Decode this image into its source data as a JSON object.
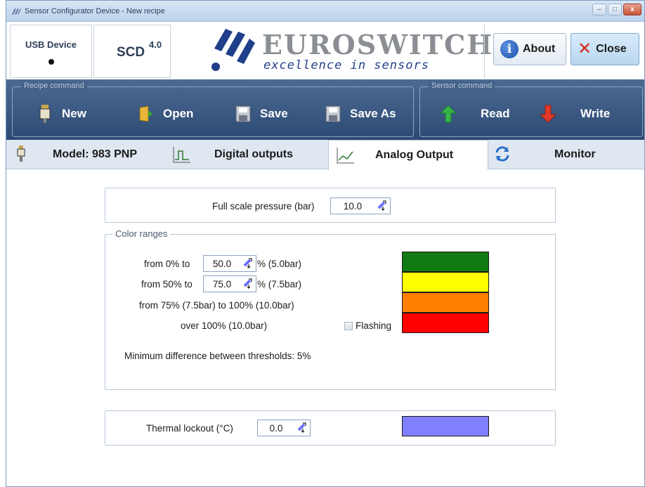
{
  "window": {
    "title": "Sensor Configurator Device - New recipe",
    "controls": {
      "minimize": "–",
      "maximize": "□",
      "close": "x"
    }
  },
  "header": {
    "usb_label": "USB Device",
    "product": "SCD",
    "product_version": "4.0",
    "brand": "EUROSWITCH",
    "tagline": "excellence in sensors",
    "about_label": "About",
    "close_label": "Close"
  },
  "recipe_command": {
    "group_label": "Recipe command",
    "new_label": "New",
    "open_label": "Open",
    "save_label": "Save",
    "save_as_label": "Save As"
  },
  "sensor_command": {
    "group_label": "Sensor command",
    "read_label": "Read",
    "write_label": "Write"
  },
  "tabs": [
    {
      "label": "Model: 983 PNP",
      "icon": "sensor-icon"
    },
    {
      "label": "Digital outputs",
      "icon": "pulse-icon"
    },
    {
      "label": "Analog Output",
      "icon": "analog-icon",
      "active": true
    },
    {
      "label": "Monitor",
      "icon": "refresh-icon"
    }
  ],
  "full_scale": {
    "label": "Full scale  pressure (bar)",
    "value": "10.0"
  },
  "color_ranges": {
    "legend": "Color ranges",
    "row1_prefix": "from 0% to",
    "row1_value": "50.0",
    "row1_suffix": "% (5.0bar)",
    "row2_prefix": "from 50% to",
    "row2_value": "75.0",
    "row2_suffix": "% (7.5bar)",
    "row3": "from 75% (7.5bar) to 100% (10.0bar)",
    "row4": "over 100% (10.0bar)",
    "flashing_label": "Flashing",
    "flashing_checked": false,
    "note": "Minimum difference between thresholds: 5%",
    "colors": [
      "#117a12",
      "#ffff00",
      "#ff7f00",
      "#ff0000"
    ]
  },
  "thermal": {
    "label": "Thermal lockout  (°C)",
    "value": "0.0",
    "color": "#8080ff"
  }
}
